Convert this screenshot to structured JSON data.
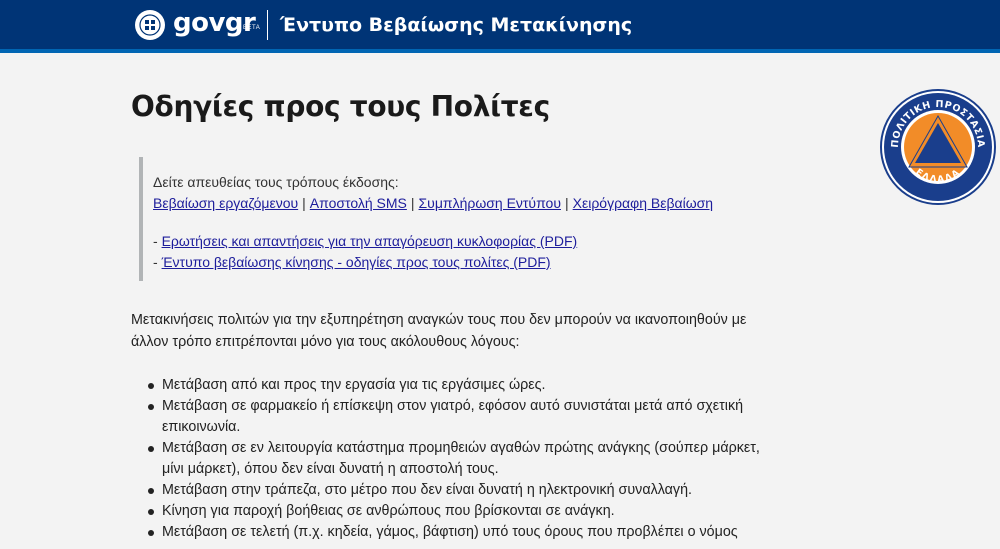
{
  "header": {
    "brand": "govgr",
    "beta": "BETA",
    "site_title": "Έντυπο Βεβαίωσης Μετακίνησης"
  },
  "page_title": "Οδηγίες προς τους Πολίτες",
  "callout": {
    "intro": "Δείτε απευθείας τους τρόπους έκδοσης:",
    "links": [
      {
        "label": "Βεβαίωση εργαζόμενου"
      },
      {
        "label": "Αποστολή SMS"
      },
      {
        "label": "Συμπλήρωση Εντύπου"
      },
      {
        "label": "Χειρόγραφη Βεβαίωση"
      }
    ],
    "separator": "|",
    "doc_prefix": "- ",
    "docs": [
      {
        "label": "Ερωτήσεις και απαντήσεις για την απαγόρευση κυκλοφορίας (PDF)"
      },
      {
        "label": "Έντυπο βεβαίωσης κίνησης - οδηγίες προς τους πολίτες (PDF)"
      }
    ]
  },
  "intro_paragraph": "Μετακινήσεις πολιτών για την εξυπηρέτηση αναγκών τους που δεν μπορούν να ικανοποιηθούν με άλλον τρόπο επιτρέπονται μόνο για τους ακόλουθους λόγους:",
  "reasons": [
    "Μετάβαση από και προς την εργασία για τις εργάσιμες ώρες.",
    "Μετάβαση σε φαρμακείο ή επίσκεψη στον γιατρό, εφόσον αυτό συνιστάται μετά από σχετική επικοινωνία.",
    "Μετάβαση σε εν λειτουργία κατάστημα προμηθειών αγαθών πρώτης ανάγκης (σούπερ μάρκετ, μίνι μάρκετ), όπου δεν είναι δυνατή η αποστολή τους.",
    "Μετάβαση στην τράπεζα, στο μέτρο που δεν είναι δυνατή η ηλεκτρονική συναλλαγή.",
    "Κίνηση για παροχή βοήθειας σε ανθρώπους που βρίσκονται σε ανάγκη.",
    "Μετάβαση σε τελετή (π.χ. κηδεία, γάμος, βάφτιση) υπό τους όρους που προβλέπει ο νόμος"
  ],
  "logo": {
    "text_top": "ΠΟΛΙΤΙΚΗ ΠΡΟΣΤΑΣΙΑ",
    "text_bottom": "ΕΛΛΑΔΑ",
    "ring_color": "#1a3e8c",
    "triangle_color": "#f28c28",
    "inner_color": "#1a3e8c"
  }
}
